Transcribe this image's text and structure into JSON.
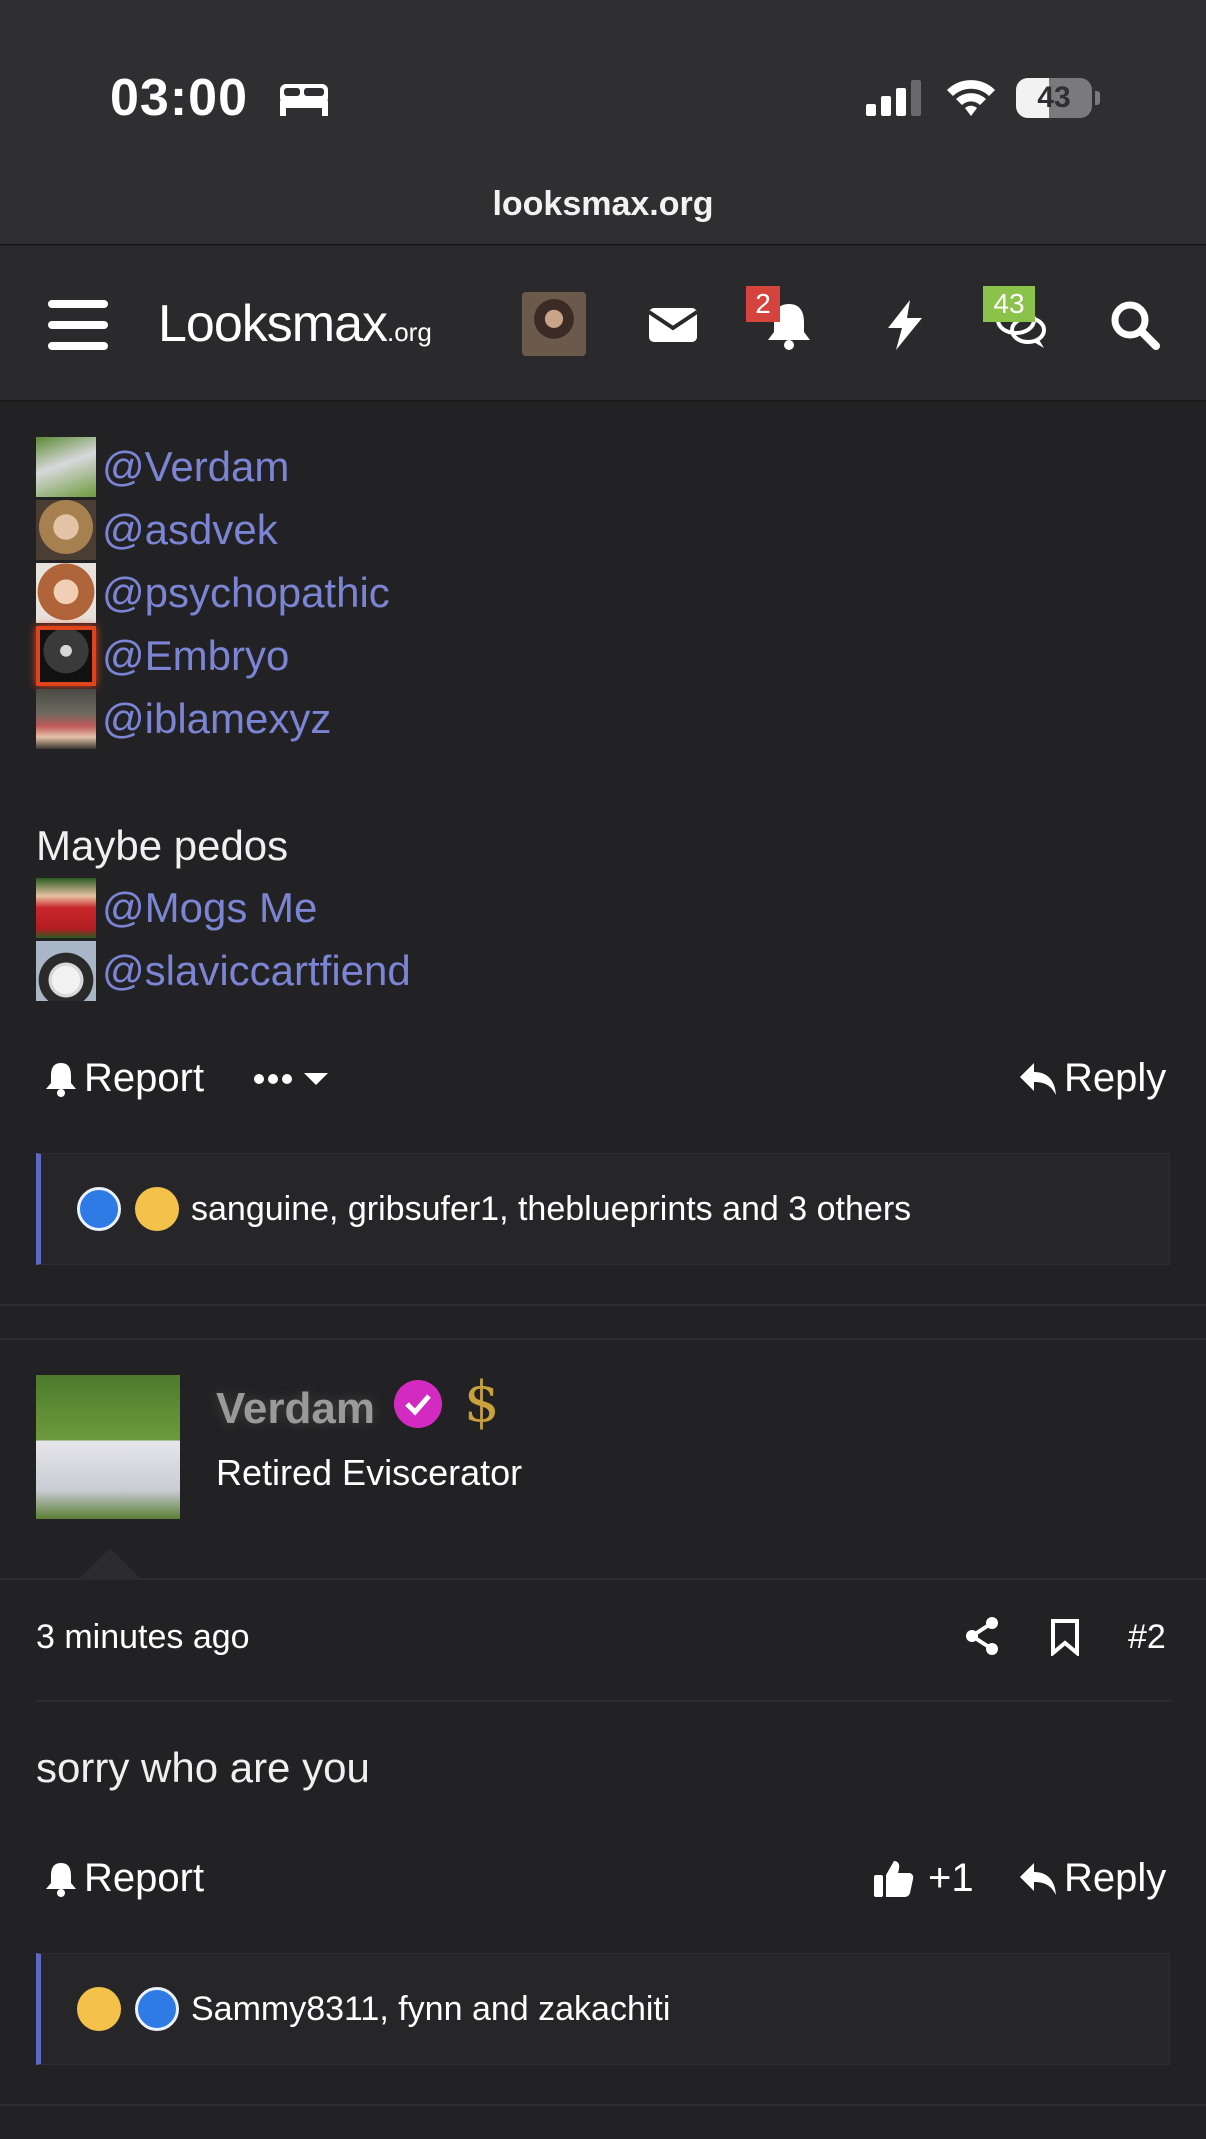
{
  "status_bar": {
    "time": "03:00",
    "battery_level": "43",
    "battery_fraction": 0.43
  },
  "browser": {
    "url": "looksmax.org"
  },
  "nav": {
    "logo": "Looksmax",
    "logo_suffix": ".org",
    "alerts_badge": "2",
    "conversations_badge": "43"
  },
  "post1": {
    "mentions_group1": [
      "@Verdam",
      "@asdvek",
      "@psychopathic",
      "@Embryo",
      "@iblamexyz"
    ],
    "subheading": "Maybe pedos",
    "mentions_group2": [
      "@Mogs Me",
      "@slaviccartfiend"
    ],
    "report_label": "Report",
    "reply_label": "Reply",
    "reactions_text": "sanguine, gribsufer1, theblueprints and 3 others"
  },
  "post2": {
    "username": "Verdam",
    "user_title": "Retired Eviscerator",
    "timestamp": "3 minutes ago",
    "post_number": "#2",
    "body": "sorry who are you",
    "report_label": "Report",
    "like_count": "+1",
    "reply_label": "Reply",
    "reactions_text": "Sammy8311, fynn and zakachiti"
  },
  "icons": [
    "bed-icon",
    "signal-icon",
    "wifi-icon",
    "battery-icon",
    "menu-icon",
    "mail-icon",
    "bell-icon",
    "bolt-icon",
    "chat-icon",
    "search-icon",
    "report-bell-icon",
    "more-icon",
    "reply-icon",
    "share-icon",
    "bookmark-icon",
    "thumbs-up-icon"
  ]
}
